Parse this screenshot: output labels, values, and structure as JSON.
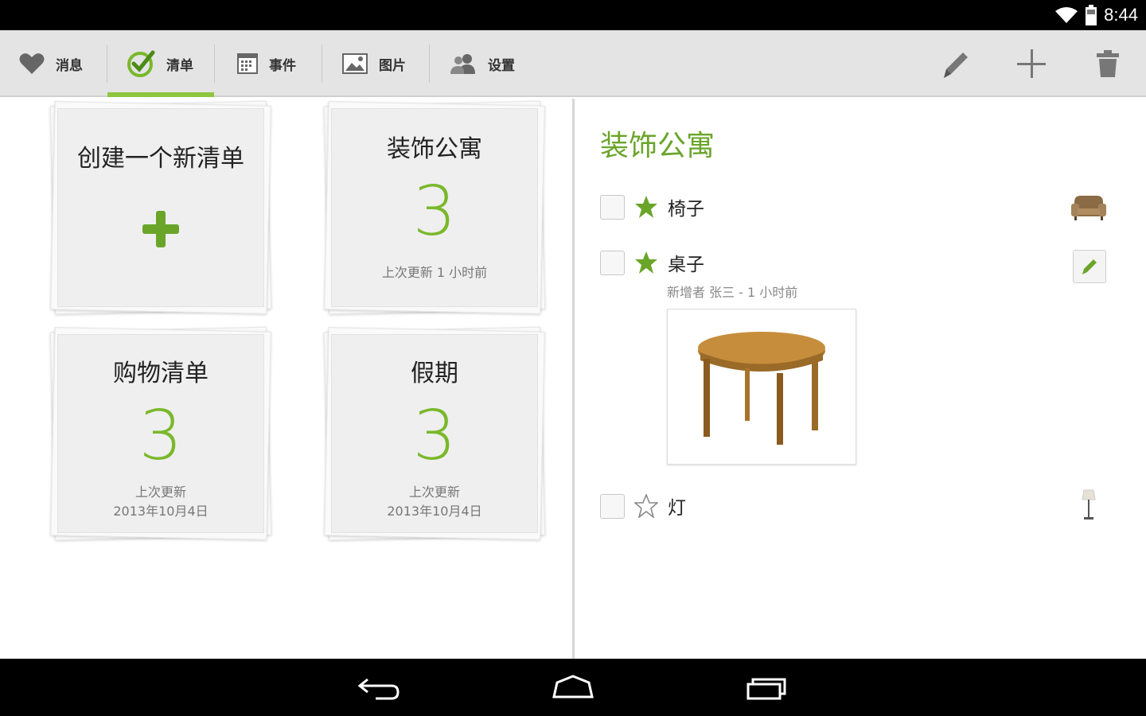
{
  "status_bar": {
    "time": "8:44",
    "icons": [
      "wifi-icon",
      "battery-icon"
    ]
  },
  "tabs": [
    {
      "label": "消息",
      "icon": "heart-icon",
      "active": false
    },
    {
      "label": "清单",
      "icon": "check-circle-icon",
      "active": true
    },
    {
      "label": "事件",
      "icon": "calendar-icon",
      "active": false
    },
    {
      "label": "图片",
      "icon": "picture-icon",
      "active": false
    },
    {
      "label": "设置",
      "icon": "people-icon",
      "active": false
    }
  ],
  "actions": [
    "pencil-icon",
    "plus-icon",
    "trash-icon"
  ],
  "colors": {
    "accent": "#8dc63f",
    "title_green": "#6aa52a",
    "count_green": "#7ab82b"
  },
  "lists": [
    {
      "title": "创建一个新清单",
      "type": "new"
    },
    {
      "title": "装饰公寓",
      "count": "3",
      "updated": "上次更新 1 小时前"
    },
    {
      "title": "购物清单",
      "count": "3",
      "updated_1": "上次更新",
      "updated_2": "2013年10月4日"
    },
    {
      "title": "假期",
      "count": "3",
      "updated_1": "上次更新",
      "updated_2": "2013年10月4日"
    }
  ],
  "detail": {
    "title": "装饰公寓",
    "items": [
      {
        "label": "椅子",
        "starred": true,
        "thumb": "armchair-icon"
      },
      {
        "label": "桌子",
        "starred": true,
        "meta": "新增者 张三 - 1 小时前",
        "thumb": "edit-icon"
      },
      {
        "label": "灯",
        "starred": false,
        "thumb": "lamp-icon"
      }
    ]
  },
  "nav": [
    "back-icon",
    "home-icon",
    "recents-icon"
  ]
}
